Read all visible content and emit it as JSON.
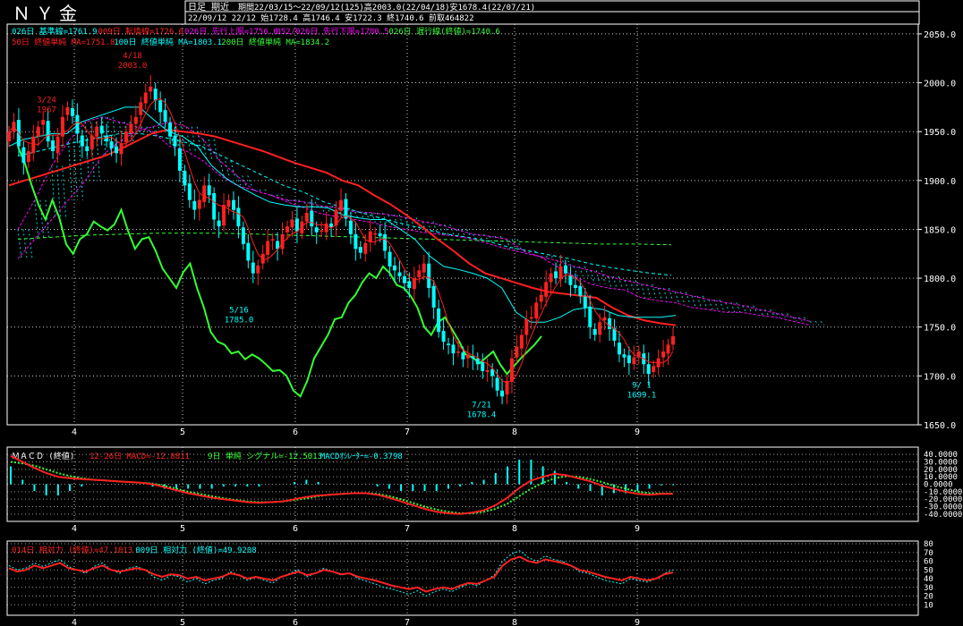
{
  "header": {
    "symbol": "ＮＹ金",
    "mode": "日足 期近",
    "period": "期間22/03/15～22/09/12(125)高2003.0(22/04/18)安1678.4(22/07/21)",
    "latest": "22/09/12 22/12 始1728.4 高1746.4 安1722.3 終1740.6 前取464822"
  },
  "colors": {
    "background": "#000000",
    "axis": "#ffffff",
    "grid": "#ffffff",
    "kijun": "#00ffff",
    "tenkan": "#ff2020",
    "senkou1": "#ff00ff",
    "senkou2": "#ff00ff",
    "kumo_fill": "#00ffff",
    "chikou": "#33ff33",
    "ma50": "#ff2020",
    "ma100": "#00ffff",
    "ma200": "#33ff33",
    "candle_up": "#ff2020",
    "candle_down": "#00ffff",
    "macd": "#ff2020",
    "signal": "#33ff33",
    "oscillator": "#00ffff",
    "rsi14": "#ff2020",
    "rsi9": "#00ffff"
  },
  "chart_data": [
    {
      "type": "candlestick",
      "legend": [
        {
          "label": "026日 基準線=1761.9",
          "color": "#00ffff"
        },
        {
          "label": "009日 転換線=1726.0",
          "color": "#ff2020"
        },
        {
          "label": "026日 先行上限=1756.6",
          "color": "#ff00ff"
        },
        {
          "label": "052/026日 先行下限=1780.5",
          "color": "#ff00ff"
        },
        {
          "label": "026日 遅行線(終値)=1740.6",
          "color": "#33ff33"
        }
      ],
      "legend2": [
        {
          "label": "50日 終値単純 MA=1751.8",
          "color": "#ff2020"
        },
        {
          "label": "100日 終値単純 MA=1803.1",
          "color": "#00ffff"
        },
        {
          "label": "200日 終値単純 MA=1834.2",
          "color": "#33ff33"
        }
      ],
      "ylim": [
        1650,
        2060
      ],
      "y_ticks": [
        1650,
        1700,
        1750,
        1800,
        1850,
        1900,
        1950,
        2000,
        2050
      ],
      "y_tick_labels": [
        "1650.0",
        "1700.0",
        "1750.0",
        "1800.0",
        "1850.0",
        "1900.0",
        "1950.0",
        "2000.0",
        "2050.0"
      ],
      "month_labels": [
        "4",
        "5",
        "6",
        "7",
        "8",
        "9"
      ],
      "annotations": [
        {
          "date": "3/24",
          "value": "1967"
        },
        {
          "date": "4/18",
          "value": "2003.0"
        },
        {
          "date": "5/16",
          "value": "1785.0"
        },
        {
          "date": "7/21",
          "value": "1678.4"
        },
        {
          "date": "9/ 1",
          "value": "1699.1"
        }
      ],
      "closes": [
        1950,
        1960,
        1935,
        1918,
        1930,
        1945,
        1955,
        1962,
        1940,
        1930,
        1945,
        1965,
        1975,
        1966,
        1948,
        1935,
        1930,
        1946,
        1955,
        1948,
        1940,
        1933,
        1928,
        1938,
        1950,
        1958,
        1965,
        1980,
        1990,
        1996,
        1982,
        1970,
        1960,
        1945,
        1935,
        1910,
        1895,
        1880,
        1870,
        1880,
        1895,
        1885,
        1860,
        1853,
        1875,
        1880,
        1870,
        1853,
        1835,
        1818,
        1805,
        1813,
        1825,
        1838,
        1840,
        1830,
        1845,
        1853,
        1860,
        1848,
        1858,
        1867,
        1853,
        1847,
        1849,
        1856,
        1852,
        1870,
        1880,
        1861,
        1845,
        1830,
        1826,
        1836,
        1848,
        1846,
        1843,
        1828,
        1812,
        1808,
        1802,
        1795,
        1790,
        1800,
        1808,
        1815,
        1790,
        1770,
        1745,
        1735,
        1732,
        1723,
        1725,
        1717,
        1722,
        1718,
        1712,
        1705,
        1706,
        1700,
        1685,
        1679,
        1695,
        1718,
        1730,
        1742,
        1758,
        1760,
        1775,
        1783,
        1796,
        1805,
        1800,
        1812,
        1805,
        1793,
        1790,
        1782,
        1770,
        1750,
        1742,
        1755,
        1760,
        1748,
        1736,
        1722,
        1719,
        1713,
        1719,
        1725,
        1712,
        1702,
        1710,
        1718,
        1725,
        1732,
        1740.6
      ],
      "kijun": [
        1935,
        1942,
        1945,
        1948,
        1948,
        1960,
        1965,
        1970,
        1975,
        1975,
        1962,
        1950,
        1945,
        1935,
        1915,
        1902,
        1893,
        1885,
        1878,
        1875,
        1873,
        1873,
        1872,
        1865,
        1862,
        1860,
        1860,
        1850,
        1840,
        1823,
        1812,
        1809,
        1805,
        1800,
        1790,
        1765,
        1755,
        1755,
        1760,
        1768,
        1770,
        1768,
        1762,
        1760,
        1760,
        1760,
        1762
      ],
      "kumo_upper": [
        1850,
        1880,
        1915,
        1940,
        1960,
        1965,
        1960,
        1955,
        1950,
        1935,
        1930,
        1920,
        1905,
        1895,
        1890,
        1885,
        1880,
        1878,
        1874,
        1872,
        1868,
        1867,
        1865,
        1862,
        1858,
        1855,
        1850,
        1845,
        1843,
        1840,
        1828,
        1822,
        1812,
        1802,
        1794,
        1790,
        1788,
        1780,
        1777,
        1775,
        1770,
        1768,
        1765,
        1765,
        1762,
        1760,
        1756,
        1752
      ],
      "kumo_lower": [
        1820,
        1840,
        1860,
        1880,
        1900,
        1925,
        1940,
        1950,
        1955,
        1960,
        1955,
        1942,
        1920,
        1905,
        1890,
        1885,
        1878,
        1872,
        1866,
        1863,
        1860,
        1857,
        1853,
        1850,
        1847,
        1845,
        1843,
        1840,
        1835,
        1830,
        1826,
        1822,
        1818,
        1812,
        1808,
        1802,
        1798,
        1794,
        1790,
        1786,
        1782,
        1778,
        1775,
        1772,
        1768,
        1764,
        1760,
        1756
      ],
      "chikou": [
        1935,
        1918,
        1895,
        1875,
        1860,
        1880,
        1862,
        1835,
        1825,
        1840,
        1845,
        1858,
        1853,
        1849,
        1855,
        1870,
        1848,
        1830,
        1840,
        1842,
        1828,
        1810,
        1800,
        1790,
        1806,
        1815,
        1790,
        1770,
        1745,
        1735,
        1732,
        1723,
        1725,
        1717,
        1722,
        1718,
        1712,
        1705,
        1706,
        1700,
        1685,
        1679,
        1695,
        1718,
        1730,
        1742,
        1758,
        1760,
        1775,
        1783,
        1796,
        1805,
        1800,
        1812,
        1805,
        1793,
        1790,
        1782,
        1770,
        1750,
        1742,
        1755,
        1760,
        1748,
        1736,
        1722,
        1719,
        1713,
        1719,
        1725,
        1712,
        1702,
        1710,
        1718,
        1725,
        1732,
        1740.6
      ],
      "ma50": [
        1895,
        1900,
        1905,
        1910,
        1915,
        1920,
        1925,
        1932,
        1940,
        1948,
        1952,
        1950,
        1948,
        1945,
        1940,
        1935,
        1930,
        1924,
        1918,
        1913,
        1908,
        1900,
        1895,
        1885,
        1876,
        1865,
        1853,
        1840,
        1828,
        1815,
        1805,
        1800,
        1795,
        1790,
        1786,
        1784,
        1782,
        1780,
        1770,
        1762,
        1757,
        1754,
        1751.8
      ],
      "ma100": [
        1925,
        1930,
        1935,
        1940,
        1944,
        1948,
        1948,
        1945,
        1940,
        1935,
        1925,
        1915,
        1905,
        1895,
        1888,
        1878,
        1872,
        1866,
        1860,
        1855,
        1850,
        1845,
        1842,
        1838,
        1832,
        1828,
        1824,
        1820,
        1815,
        1811,
        1808,
        1805,
        1803.1
      ],
      "ma200": [
        1840,
        1842,
        1844,
        1845,
        1846,
        1846,
        1846,
        1845,
        1844,
        1843,
        1842,
        1841,
        1840,
        1839,
        1838,
        1837,
        1836,
        1835,
        1835,
        1834.2
      ]
    },
    {
      "type": "line",
      "legend": [
        {
          "label": "12-26日 MACD=-12.8811",
          "color": "#ff2020"
        },
        {
          "label": "9日 単純 シグナル=-12.5013",
          "color": "#33ff33"
        },
        {
          "label": "MACDｵｼﾚｰﾀｰ=-0.3798",
          "color": "#00ffff"
        }
      ],
      "title": "ＭＡＣＤ (終値)",
      "ylim": [
        -45,
        45
      ],
      "y_tick_labels": [
        "40.0000",
        "30.0000",
        "20.0000",
        "10.0000",
        "0.0000",
        "-10.0000",
        "-20.0000",
        "-30.0000",
        "-40.0000"
      ],
      "macd": [
        38,
        30,
        22,
        15,
        10,
        8,
        7,
        6,
        5,
        4,
        3,
        2,
        0,
        -4,
        -8,
        -12,
        -15,
        -18,
        -20,
        -22,
        -24,
        -25,
        -24,
        -23,
        -20,
        -17,
        -15,
        -14,
        -13,
        -12,
        -12,
        -14,
        -18,
        -23,
        -28,
        -33,
        -37,
        -39,
        -40,
        -38,
        -35,
        -28,
        -18,
        -5,
        5,
        10,
        14,
        12,
        8,
        4,
        -2,
        -6,
        -10,
        -13,
        -14,
        -13,
        -12.9
      ],
      "signal": [
        30,
        28,
        25,
        20,
        15,
        11,
        8,
        6,
        5,
        4,
        3,
        2,
        1,
        -2,
        -6,
        -10,
        -13,
        -16,
        -19,
        -21,
        -23,
        -24,
        -24,
        -23,
        -21,
        -19,
        -16,
        -14,
        -13,
        -12,
        -12,
        -13,
        -16,
        -20,
        -25,
        -30,
        -34,
        -37,
        -39,
        -39,
        -37,
        -33,
        -26,
        -16,
        -6,
        2,
        8,
        11,
        10,
        7,
        3,
        -2,
        -6,
        -10,
        -12,
        -12.5,
        -12.5
      ],
      "oscillator": [
        8,
        2,
        -3,
        -5,
        -5,
        -3,
        -1,
        0,
        0,
        0,
        0,
        0,
        -1,
        -2,
        -2,
        -2,
        -2,
        -2,
        -1,
        -1,
        -1,
        -1,
        0,
        0,
        1,
        2,
        1,
        0,
        0,
        0,
        0,
        -1,
        -2,
        -3,
        -3,
        -3,
        -3,
        -2,
        -1,
        1,
        2,
        5,
        8,
        11,
        11,
        8,
        6,
        1,
        -2,
        -3,
        -5,
        -4,
        -4,
        -3,
        -2,
        -0.5,
        -0.4
      ]
    },
    {
      "type": "line",
      "legend": [
        {
          "label": "014日 相対力 (終値)=47.1013",
          "color": "#ff2020"
        },
        {
          "label": "009日 相対力 (終値)=49.9208",
          "color": "#00ffff"
        }
      ],
      "ylim": [
        0,
        80
      ],
      "y_tick_labels": [
        "80",
        "70",
        "60",
        "50",
        "40",
        "30",
        "20",
        "10"
      ],
      "rsi14": [
        52,
        48,
        50,
        55,
        52,
        55,
        58,
        52,
        50,
        48,
        52,
        55,
        50,
        48,
        50,
        52,
        50,
        45,
        42,
        45,
        44,
        40,
        42,
        38,
        40,
        42,
        46,
        44,
        40,
        42,
        40,
        38,
        42,
        45,
        48,
        44,
        46,
        50,
        48,
        45,
        46,
        42,
        40,
        38,
        35,
        32,
        30,
        28,
        30,
        25,
        28,
        30,
        28,
        32,
        35,
        34,
        38,
        42,
        55,
        62,
        65,
        60,
        58,
        62,
        60,
        58,
        55,
        50,
        48,
        45,
        42,
        40,
        38,
        42,
        40,
        38,
        40,
        45,
        47.1
      ],
      "rsi9": [
        55,
        50,
        52,
        58,
        54,
        58,
        62,
        54,
        50,
        46,
        54,
        58,
        50,
        46,
        52,
        54,
        50,
        42,
        38,
        44,
        42,
        36,
        40,
        34,
        38,
        40,
        48,
        44,
        38,
        42,
        38,
        35,
        42,
        46,
        50,
        42,
        46,
        52,
        48,
        44,
        46,
        40,
        37,
        34,
        30,
        28,
        25,
        22,
        26,
        20,
        25,
        28,
        25,
        30,
        34,
        32,
        38,
        44,
        60,
        68,
        72,
        64,
        60,
        66,
        62,
        60,
        55,
        48,
        46,
        42,
        38,
        36,
        34,
        40,
        38,
        36,
        40,
        46,
        49.9
      ]
    }
  ]
}
